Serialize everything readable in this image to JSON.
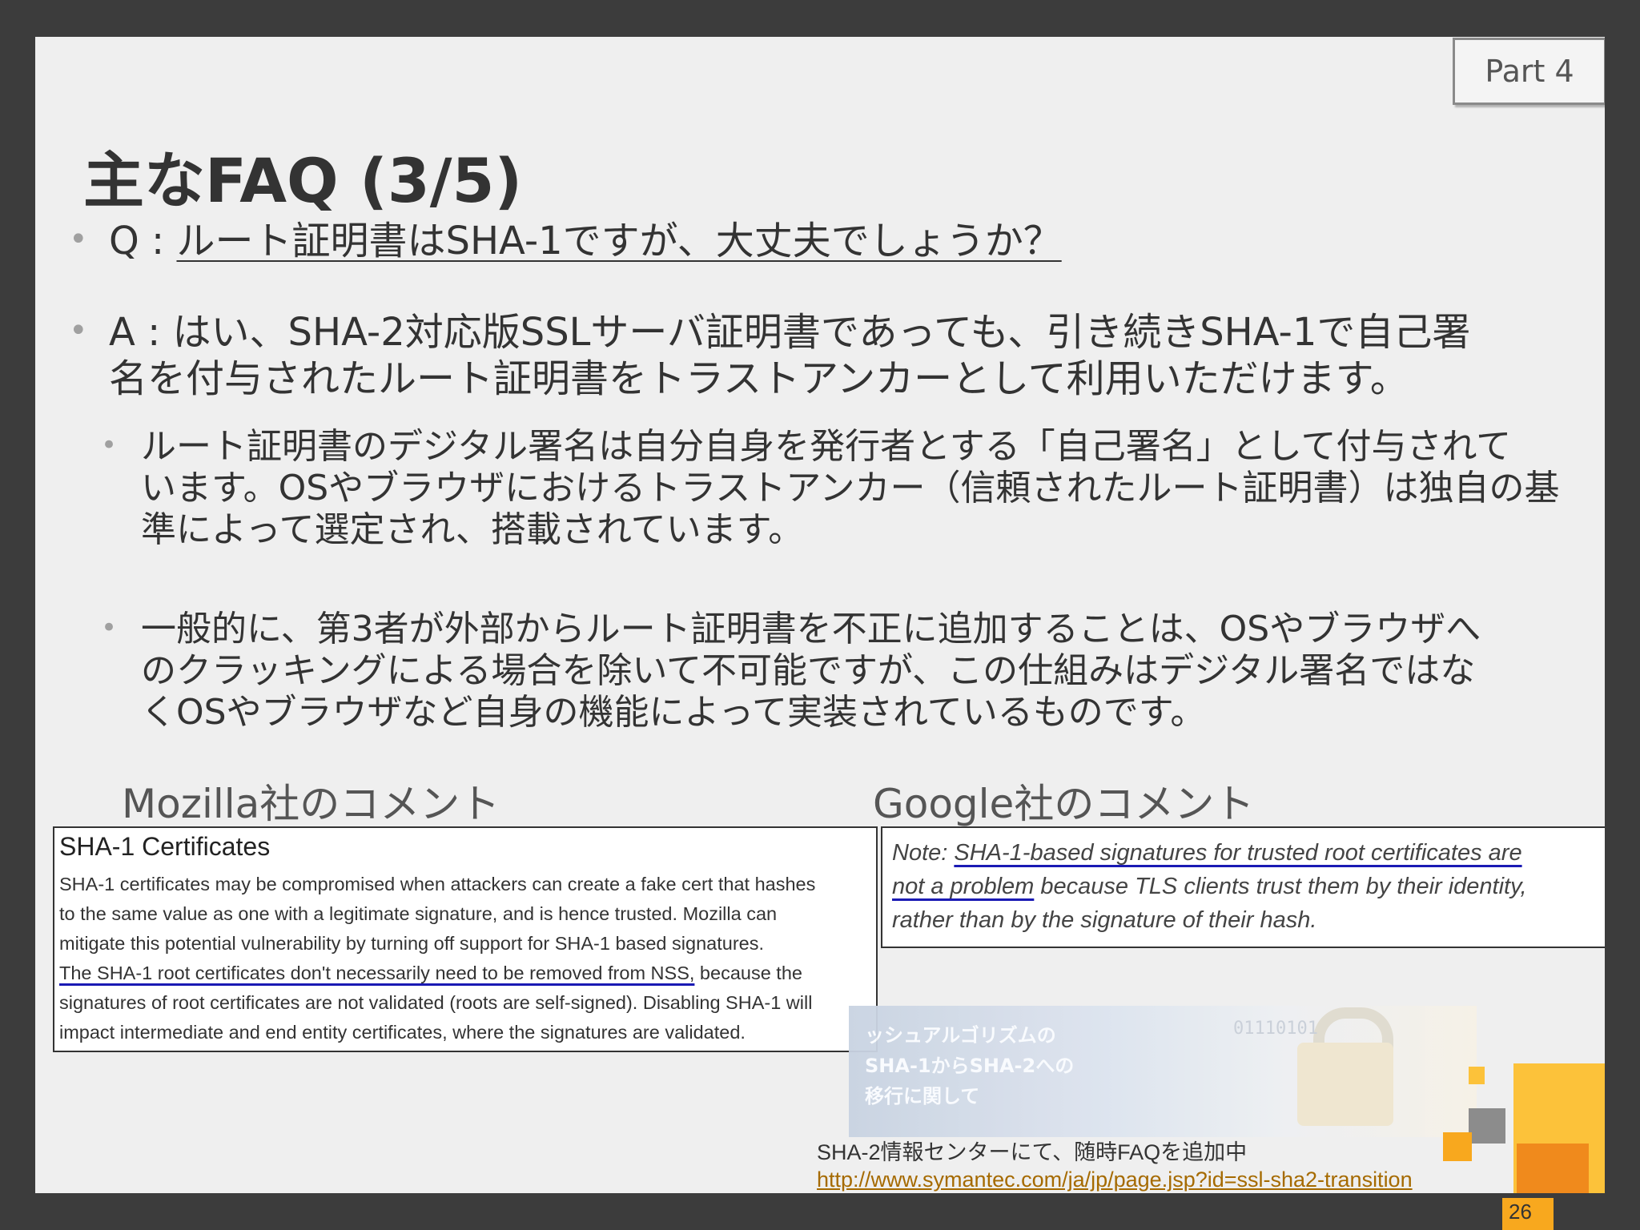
{
  "header": {
    "part_label": "Part 4"
  },
  "title": "主なFAQ (3/5)",
  "faq": {
    "q_prefix": "Q : ",
    "q_text": "ルート証明書はSHA-1ですが、大丈夫でしょうか？",
    "a_line1": "A : はい、SHA-2対応版SSLサーバ証明書であっても、引き続きSHA-1で自己署",
    "a_line2": "名を付与されたルート証明書をトラストアンカーとして利用いただけます。",
    "sub1_line1": "ルート証明書のデジタル署名は自分自身を発行者とする「自己署名」として付与されて",
    "sub1_line2": "います。OSやブラウザにおけるトラストアンカー（信頼されたルート証明書）は独自の基",
    "sub1_line3": "準によって選定され、搭載されています。",
    "sub2_line1": "一般的に、第3者が外部からルート証明書を不正に追加することは、OSやブラウザへ",
    "sub2_line2": "のクラッキングによる場合を除いて不可能ですが、この仕組みはデジタル署名ではな",
    "sub2_line3": "くOSやブラウザなど自身の機能によって実装されているものです。"
  },
  "mozilla": {
    "heading": "Mozilla社のコメント",
    "box_title": "SHA-1 Certificates",
    "line1": "SHA-1 certificates may be compromised when attackers can create a fake cert that hashes",
    "line2": "to the same value as one with a legitimate signature, and is hence trusted. Mozilla can",
    "line3": "mitigate this potential vulnerability by turning off support for SHA-1 based signatures.",
    "line4_underlined": "The SHA-1 root certificates don't necessarily need to be removed from NSS,",
    "line4_rest": " because the",
    "line5": "signatures of root certificates are not validated (roots are self-signed). Disabling SHA-1 will",
    "line6": "impact intermediate and end entity certificates, where the signatures are validated."
  },
  "google": {
    "heading": "Google社のコメント",
    "note_prefix": "Note: ",
    "note_underlined1": "SHA-1-based signatures for trusted root certificates are",
    "note_underlined2": "not a problem",
    "note_rest": " because TLS clients trust them by their identity,",
    "note_line3": "rather than by the signature of their hash."
  },
  "banner": {
    "text": "ッシュアルゴリズムの\nSHA-1からSHA-2への\n移行に関して",
    "bits": "01110101"
  },
  "footer": {
    "info_text": "SHA-2情報センターにて、随時FAQを追加中",
    "link": "http://www.symantec.com/ja/jp/page.jsp?id=ssl-sha2-transition",
    "page_number": "26"
  },
  "colors": {
    "accent_orange": "#f8a81e",
    "accent_dark_orange": "#f08a1c",
    "accent_yellow": "#fcc23a",
    "underline_blue": "#1a1ab4"
  }
}
